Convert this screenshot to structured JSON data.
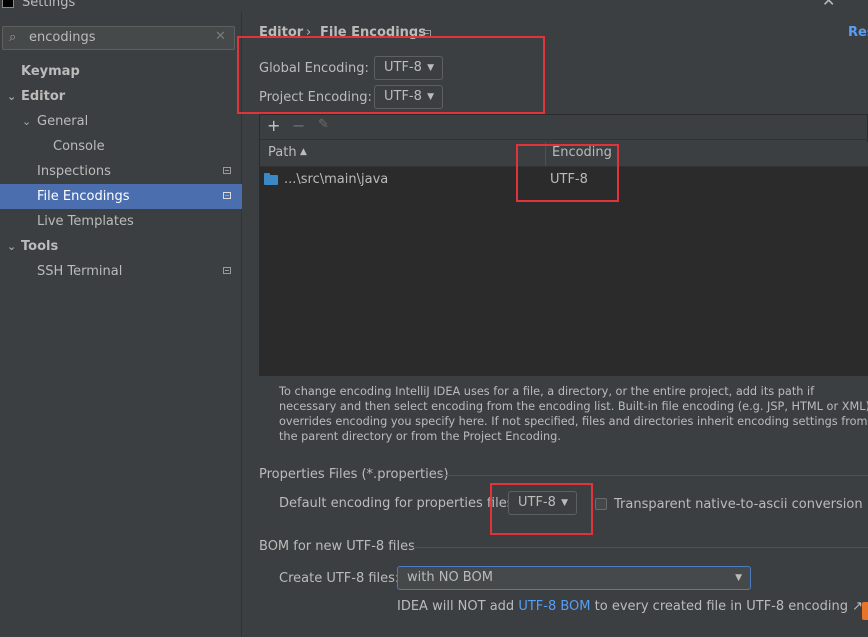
{
  "window": {
    "title": "Settings",
    "close_glyph": "✕"
  },
  "search": {
    "value": "encodings",
    "clear_glyph": "✕"
  },
  "sidebar": {
    "items": [
      {
        "label": "Keymap"
      },
      {
        "label": "Editor"
      },
      {
        "label": "General"
      },
      {
        "label": "Console"
      },
      {
        "label": "Inspections"
      },
      {
        "label": "File Encodings"
      },
      {
        "label": "Live Templates"
      },
      {
        "label": "Tools"
      },
      {
        "label": "SSH Terminal"
      }
    ],
    "selected_index": 5
  },
  "breadcrumb": {
    "parent": "Editor",
    "separator": "›",
    "current": "File Encodings",
    "reset_label": "Res"
  },
  "global_encoding": {
    "label": "Global Encoding:",
    "value": "UTF-8"
  },
  "project_encoding": {
    "label": "Project Encoding:",
    "value": "UTF-8"
  },
  "table": {
    "toolbar": {
      "add": "+",
      "remove": "−",
      "edit": "✎"
    },
    "columns": [
      {
        "label": "Path",
        "sort": "▲"
      },
      {
        "label": "Encoding"
      }
    ],
    "rows": [
      {
        "path": "...\\src\\main\\java",
        "encoding": "UTF-8"
      }
    ]
  },
  "description": "To change encoding IntelliJ IDEA uses for a file, a directory, or the entire project, add its path if necessary and then select encoding from the encoding list. Built-in file encoding (e.g. JSP, HTML or XML) overrides encoding you specify here. If not specified, files and directories inherit encoding settings from the parent directory or from the Project Encoding.",
  "properties": {
    "section_title": "Properties Files (*.properties)",
    "default_label": "Default encoding for properties files:",
    "default_value": "UTF-8",
    "transparent_label": "Transparent native-to-ascii conversion",
    "transparent_checked": false
  },
  "bom": {
    "section_title": "BOM for new UTF-8 files",
    "create_label": "Create UTF-8 files:",
    "create_value": "with NO BOM",
    "note_prefix": "IDEA will NOT add",
    "note_link": "UTF-8 BOM",
    "note_suffix": "to every created file in UTF-8 encoding",
    "note_arrow": "↗"
  },
  "colors": {
    "selection": "#4b6eaf",
    "highlight_box": "#e0343a",
    "link": "#589df6",
    "folder": "#3a88c6"
  }
}
